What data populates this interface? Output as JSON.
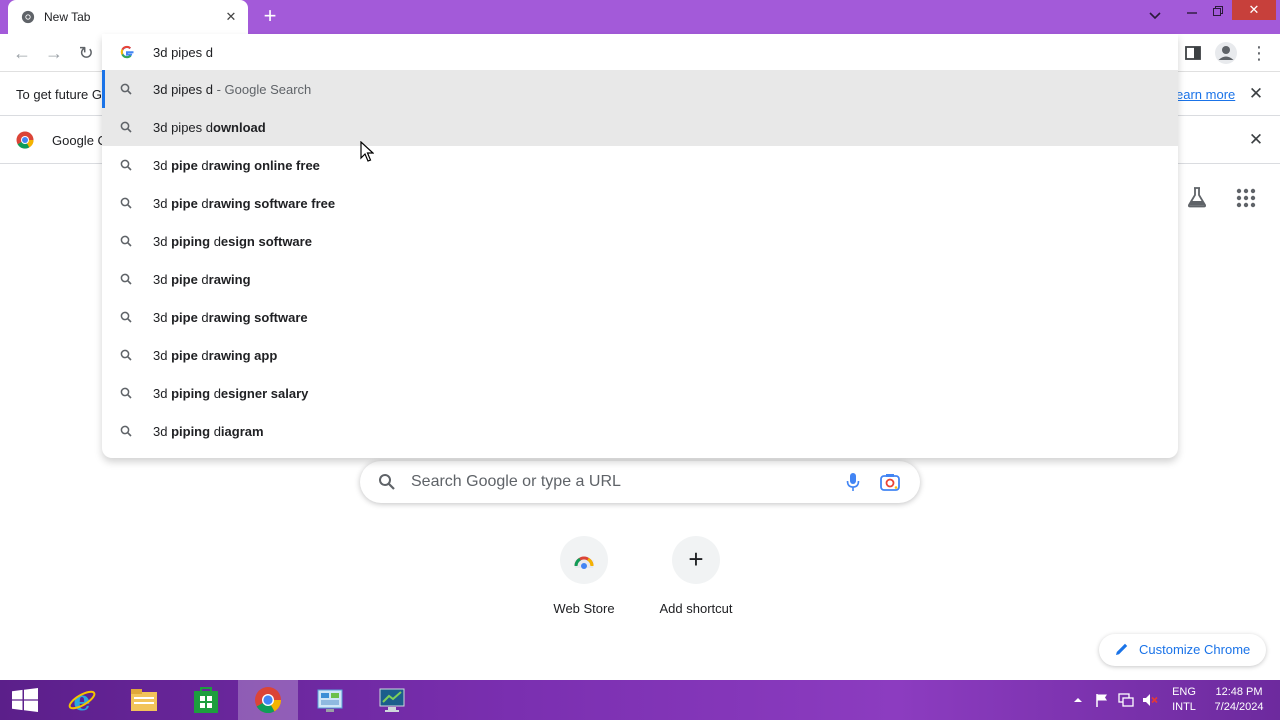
{
  "browser": {
    "tab_title": "New Tab",
    "tab_close": "✕",
    "new_tab": "+"
  },
  "infobars": {
    "bar1_text": "To get future G",
    "bar1_link": "earn more",
    "bar2_text": "Google C"
  },
  "omnibox": {
    "input_value": "3d pipes d",
    "suggestions": [
      {
        "pre": "3d pipes d",
        "bold": "",
        "suffix": " - Google Search"
      },
      {
        "pre": "3d pipes d",
        "bold": "ownload",
        "suffix": ""
      },
      {
        "pre": "3d ",
        "bold": "pipe",
        "mid": " d",
        "bold2": "rawing online free"
      },
      {
        "pre": "3d ",
        "bold": "pipe",
        "mid": " d",
        "bold2": "rawing software free"
      },
      {
        "pre": "3d ",
        "bold": "piping",
        "mid": " d",
        "bold2": "esign software"
      },
      {
        "pre": "3d ",
        "bold": "pipe",
        "mid": " d",
        "bold2": "rawing"
      },
      {
        "pre": "3d ",
        "bold": "pipe",
        "mid": " d",
        "bold2": "rawing software"
      },
      {
        "pre": "3d ",
        "bold": "pipe",
        "mid": " d",
        "bold2": "rawing app"
      },
      {
        "pre": "3d ",
        "bold": "piping",
        "mid": " d",
        "bold2": "esigner salary"
      },
      {
        "pre": "3d ",
        "bold": "piping",
        "mid": " d",
        "bold2": "iagram"
      }
    ]
  },
  "ntp": {
    "search_placeholder": "Search Google or type a URL",
    "shortcuts": [
      {
        "label": "Web Store"
      },
      {
        "label": "Add shortcut"
      }
    ],
    "customize_label": "Customize Chrome"
  },
  "taskbar": {
    "lang_line1": "ENG",
    "lang_line2": "INTL",
    "time": "12:48 PM",
    "date": "7/24/2024"
  },
  "colors": {
    "titlebar": "#a35ad9",
    "accent": "#1a73e8",
    "taskbar": "#7a2fb0"
  }
}
